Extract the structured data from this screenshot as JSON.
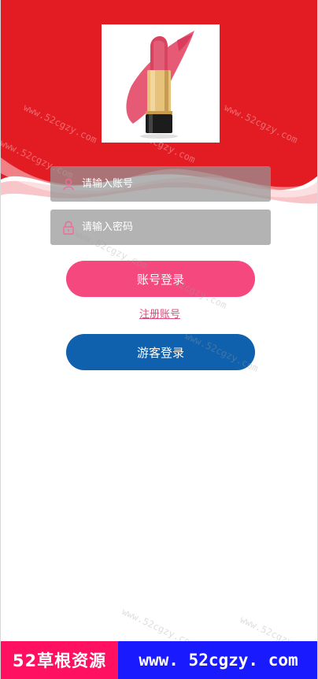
{
  "header": {
    "background_color": "#e31b23",
    "product_image": "lipstick-image"
  },
  "login_form": {
    "account_placeholder": "请输入账号",
    "password_placeholder": "请输入密码",
    "login_button_label": "账号登录",
    "register_link_label": "注册账号",
    "guest_button_label": "游客登录"
  },
  "colors": {
    "login_button": "#f5487f",
    "guest_button": "#0f60ad",
    "register_link": "#e0497b",
    "icon_accent": "#f06a97"
  },
  "watermark": {
    "text": "www.52cgzy.com"
  },
  "banner": {
    "left_text": "52草根资源",
    "right_text": "www. 52cgzy. com",
    "left_color": "#ff1060",
    "right_color": "#1a1aff"
  }
}
